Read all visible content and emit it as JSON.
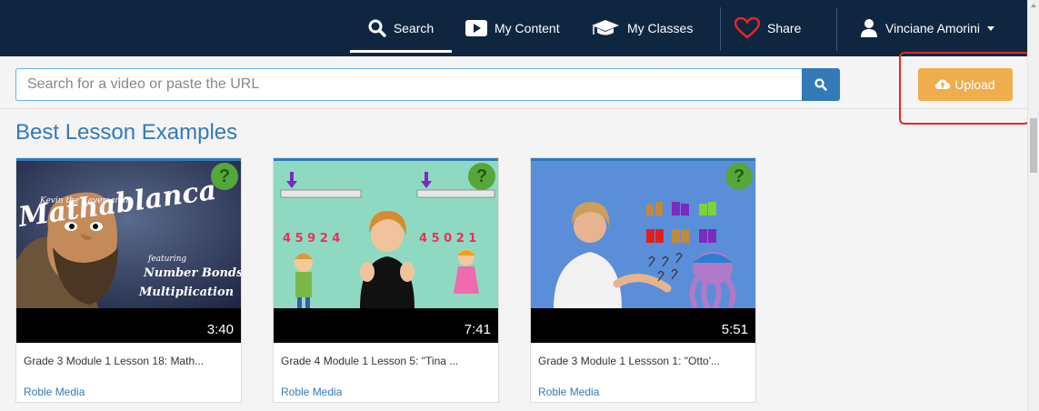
{
  "nav": {
    "search_label": "Search",
    "content_label": "My Content",
    "classes_label": "My Classes",
    "share_label": "Share",
    "user_name": "Vinciane Amorini"
  },
  "search": {
    "placeholder": "Search for a video or paste the URL",
    "value": ""
  },
  "upload_label": "Upload",
  "section_title": "Best Lesson Examples",
  "videos": [
    {
      "title": "Grade 3 Module 1 Lesson 18: Math...",
      "author": "Roble Media",
      "duration": "3:40",
      "thumb_text_1": "Kevin the Kaveman in",
      "thumb_text_2": "Mathablanca",
      "thumb_text_3": "featuring",
      "thumb_text_4": "Number Bonds &",
      "thumb_text_5": "Multiplication"
    },
    {
      "title": "Grade 4 Module 1 Lesson 5: \"Tina ...",
      "author": "Roble Media",
      "duration": "7:41",
      "digits_left": "4 5 9 2 4",
      "digits_right": "4 5 0 2 1"
    },
    {
      "title": "Grade 3 Module 1 Lessson 1: \"Otto'...",
      "author": "Roble Media",
      "duration": "5:51"
    }
  ],
  "badge_symbol": "?",
  "colors": {
    "topbar": "#0f2640",
    "accent": "#337ab7",
    "upload": "#f0ad4e",
    "highlight": "#e12a2a"
  }
}
